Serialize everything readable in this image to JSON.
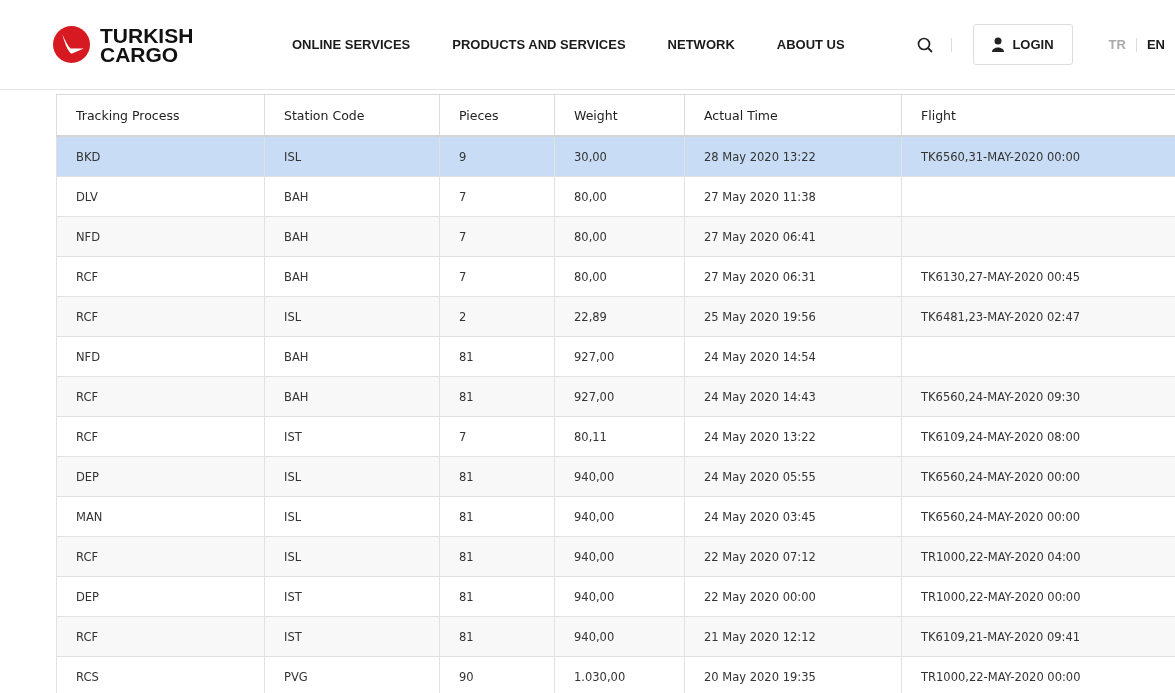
{
  "header": {
    "logo": {
      "line1": "TURKISH",
      "line2": "CARGO"
    },
    "nav": [
      "ONLINE SERVICES",
      "PRODUCTS AND SERVICES",
      "NETWORK",
      "ABOUT US"
    ],
    "login": "LOGIN",
    "languages": [
      {
        "label": "TR",
        "selected": false
      },
      {
        "label": "EN",
        "selected": true
      }
    ]
  },
  "table": {
    "columns": [
      "Tracking Process",
      "Station Code",
      "Pieces",
      "Weight",
      "Actual Time",
      "Flight"
    ],
    "rows": [
      {
        "selected": true,
        "cells": [
          "BKD",
          "ISL",
          "9",
          "30,00",
          "28 May 2020 13:22",
          "TK6560,31-MAY-2020 00:00"
        ]
      },
      {
        "selected": false,
        "cells": [
          "DLV",
          "BAH",
          "7",
          "80,00",
          "27 May 2020 11:38",
          ""
        ]
      },
      {
        "selected": false,
        "cells": [
          "NFD",
          "BAH",
          "7",
          "80,00",
          "27 May 2020 06:41",
          ""
        ]
      },
      {
        "selected": false,
        "cells": [
          "RCF",
          "BAH",
          "7",
          "80,00",
          "27 May 2020 06:31",
          "TK6130,27-MAY-2020 00:45"
        ]
      },
      {
        "selected": false,
        "cells": [
          "RCF",
          "ISL",
          "2",
          "22,89",
          "25 May 2020 19:56",
          "TK6481,23-MAY-2020 02:47"
        ]
      },
      {
        "selected": false,
        "cells": [
          "NFD",
          "BAH",
          "81",
          "927,00",
          "24 May 2020 14:54",
          ""
        ]
      },
      {
        "selected": false,
        "cells": [
          "RCF",
          "BAH",
          "81",
          "927,00",
          "24 May 2020 14:43",
          "TK6560,24-MAY-2020 09:30"
        ]
      },
      {
        "selected": false,
        "cells": [
          "RCF",
          "IST",
          "7",
          "80,11",
          "24 May 2020 13:22",
          "TK6109,24-MAY-2020 08:00"
        ]
      },
      {
        "selected": false,
        "cells": [
          "DEP",
          "ISL",
          "81",
          "940,00",
          "24 May 2020 05:55",
          "TK6560,24-MAY-2020 00:00"
        ]
      },
      {
        "selected": false,
        "cells": [
          "MAN",
          "ISL",
          "81",
          "940,00",
          "24 May 2020 03:45",
          "TK6560,24-MAY-2020 00:00"
        ]
      },
      {
        "selected": false,
        "cells": [
          "RCF",
          "ISL",
          "81",
          "940,00",
          "22 May 2020 07:12",
          "TR1000,22-MAY-2020 04:00"
        ]
      },
      {
        "selected": false,
        "cells": [
          "DEP",
          "IST",
          "81",
          "940,00",
          "22 May 2020 00:00",
          "TR1000,22-MAY-2020 00:00"
        ]
      },
      {
        "selected": false,
        "cells": [
          "RCF",
          "IST",
          "81",
          "940,00",
          "21 May 2020 12:12",
          "TK6109,21-MAY-2020 09:41"
        ]
      },
      {
        "selected": false,
        "cells": [
          "RCS",
          "PVG",
          "90",
          "1.030,00",
          "20 May 2020 19:35",
          "TR1000,22-MAY-2020 00:00"
        ]
      }
    ]
  }
}
